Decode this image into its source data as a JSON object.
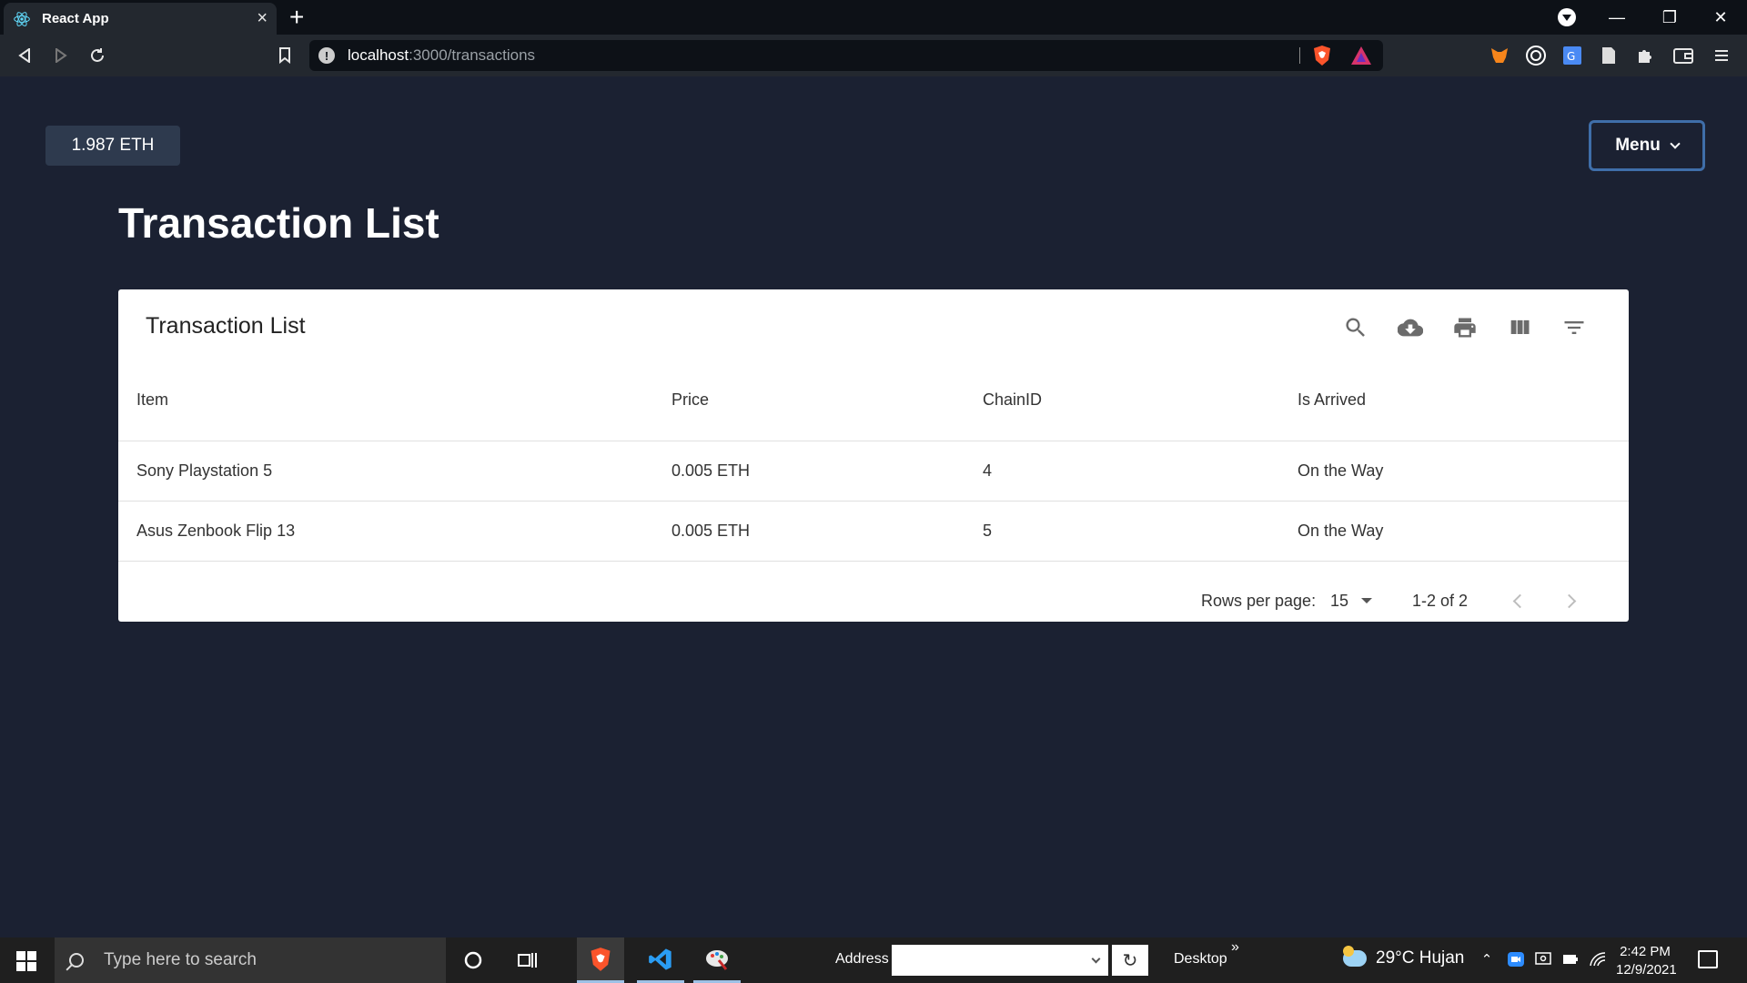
{
  "browser": {
    "tab_title": "React App",
    "tab_close": "×",
    "new_tab": "+",
    "url_host": "localhost",
    "url_path": ":3000/transactions",
    "window_controls": {
      "minimize": "—",
      "restore": "❐",
      "close": "✕"
    }
  },
  "page": {
    "balance": "1.987 ETH",
    "menu_label": "Menu",
    "title": "Transaction List"
  },
  "table": {
    "title": "Transaction List",
    "toolbar": [
      "search-icon",
      "download-icon",
      "print-icon",
      "view-columns-icon",
      "filter-icon"
    ],
    "columns": [
      "Item",
      "Price",
      "ChainID",
      "Is Arrived"
    ],
    "rows": [
      [
        "Sony Playstation 5",
        "0.005 ETH",
        "4",
        "On the Way"
      ],
      [
        "Asus Zenbook Flip 13",
        "0.005 ETH",
        "5",
        "On the Way"
      ]
    ],
    "pagination": {
      "rows_per_page_label": "Rows per page:",
      "rows_per_page": "15",
      "range": "1-2 of 2"
    }
  },
  "taskbar": {
    "search_placeholder": "Type here to search",
    "address_label": "Address",
    "address_value": "",
    "desktop_label": "Desktop",
    "desktop_more": "»",
    "weather": "29°C  Hujan",
    "time": "2:42 PM",
    "date": "12/9/2021"
  },
  "colors": {
    "page_bg": "#1b2132",
    "balance_bg": "#2e3a4e",
    "menu_border": "#3f6ea9",
    "card_bg": "#ffffff"
  }
}
